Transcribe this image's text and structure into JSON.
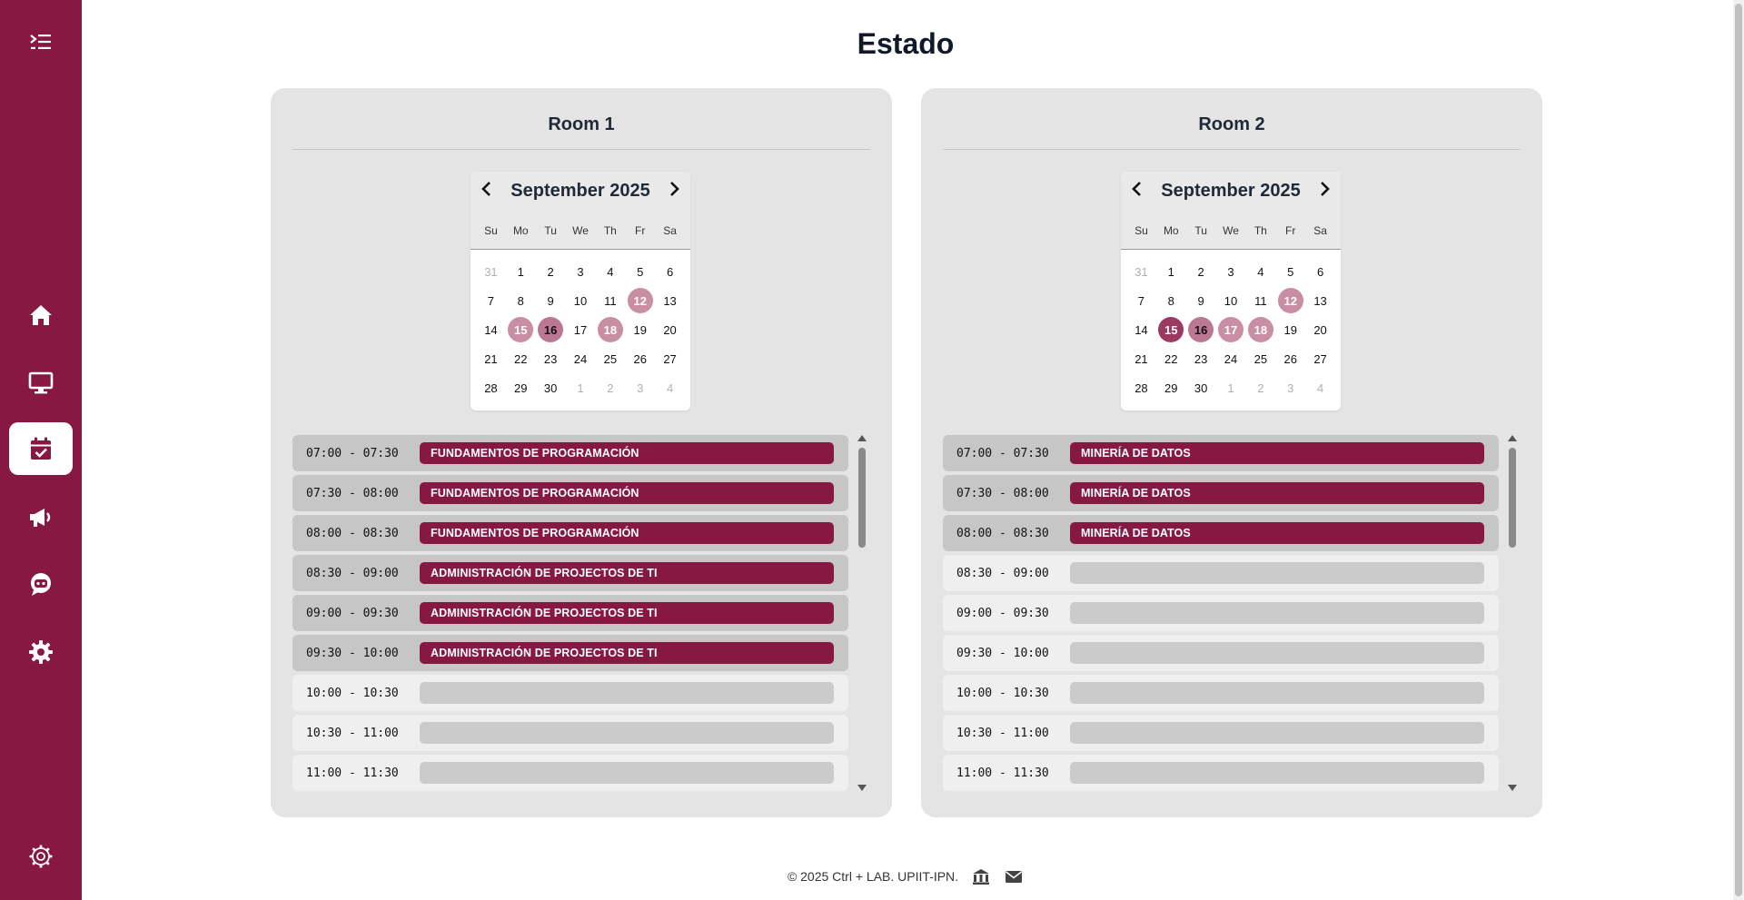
{
  "page": {
    "title": "Estado"
  },
  "colors": {
    "brand": "#861842",
    "panel": "#e4e4e4",
    "slot_booked_bg": "#c6c6c6",
    "slot_free_bar": "#cbcbcb"
  },
  "sidebar": {
    "items": [
      {
        "name": "home",
        "icon": "home-icon"
      },
      {
        "name": "monitor",
        "icon": "monitor-icon"
      },
      {
        "name": "calendar",
        "icon": "calendar-check-icon",
        "active": true
      },
      {
        "name": "announcements",
        "icon": "megaphone-icon"
      },
      {
        "name": "chatbot",
        "icon": "robot-chat-icon"
      },
      {
        "name": "settings",
        "icon": "gear-icon"
      }
    ],
    "bottom_icon": "gear-outline-icon",
    "toggle_icon": "menu-expand-icon"
  },
  "rooms": [
    {
      "title": "Room 1",
      "calendar": {
        "month_label": "September 2025",
        "weekdays": [
          "Su",
          "Mo",
          "Tu",
          "We",
          "Th",
          "Fr",
          "Sa"
        ],
        "days": [
          "31",
          "1",
          "2",
          "3",
          "4",
          "5",
          "6",
          "7",
          "8",
          "9",
          "10",
          "11",
          "12",
          "13",
          "14",
          "15",
          "16",
          "17",
          "18",
          "19",
          "20",
          "21",
          "22",
          "23",
          "24",
          "25",
          "26",
          "27",
          "28",
          "29",
          "30",
          "1",
          "2",
          "3",
          "4"
        ],
        "highlighted": {
          "12": "light",
          "15": "light",
          "16": "mid",
          "18": "light"
        }
      },
      "slots": [
        {
          "time": "07:00 - 07:30",
          "subject": "FUNDAMENTOS DE PROGRAMACIÓN"
        },
        {
          "time": "07:30 - 08:00",
          "subject": "FUNDAMENTOS DE PROGRAMACIÓN"
        },
        {
          "time": "08:00 - 08:30",
          "subject": "FUNDAMENTOS DE PROGRAMACIÓN"
        },
        {
          "time": "08:30 - 09:00",
          "subject": "ADMINISTRACIÓN DE PROJECTOS DE TI"
        },
        {
          "time": "09:00 - 09:30",
          "subject": "ADMINISTRACIÓN DE PROJECTOS DE TI"
        },
        {
          "time": "09:30 - 10:00",
          "subject": "ADMINISTRACIÓN DE PROJECTOS DE TI"
        },
        {
          "time": "10:00 - 10:30",
          "subject": ""
        },
        {
          "time": "10:30 - 11:00",
          "subject": ""
        },
        {
          "time": "11:00 - 11:30",
          "subject": ""
        }
      ]
    },
    {
      "title": "Room 2",
      "calendar": {
        "month_label": "September 2025",
        "weekdays": [
          "Su",
          "Mo",
          "Tu",
          "We",
          "Th",
          "Fr",
          "Sa"
        ],
        "days": [
          "31",
          "1",
          "2",
          "3",
          "4",
          "5",
          "6",
          "7",
          "8",
          "9",
          "10",
          "11",
          "12",
          "13",
          "14",
          "15",
          "16",
          "17",
          "18",
          "19",
          "20",
          "21",
          "22",
          "23",
          "24",
          "25",
          "26",
          "27",
          "28",
          "29",
          "30",
          "1",
          "2",
          "3",
          "4"
        ],
        "highlighted": {
          "12": "light",
          "15": "dark",
          "16": "mid",
          "17": "light",
          "18": "light"
        }
      },
      "slots": [
        {
          "time": "07:00 - 07:30",
          "subject": "MINERÍA DE DATOS"
        },
        {
          "time": "07:30 - 08:00",
          "subject": "MINERÍA DE DATOS"
        },
        {
          "time": "08:00 - 08:30",
          "subject": "MINERÍA DE DATOS"
        },
        {
          "time": "08:30 - 09:00",
          "subject": ""
        },
        {
          "time": "09:00 - 09:30",
          "subject": ""
        },
        {
          "time": "09:30 - 10:00",
          "subject": ""
        },
        {
          "time": "10:00 - 10:30",
          "subject": ""
        },
        {
          "time": "10:30 - 11:00",
          "subject": ""
        },
        {
          "time": "11:00 - 11:30",
          "subject": ""
        }
      ]
    }
  ],
  "footer": {
    "text": "© 2025 Ctrl + LAB. UPIIT-IPN.",
    "icons": [
      "institution-icon",
      "envelope-icon"
    ]
  }
}
